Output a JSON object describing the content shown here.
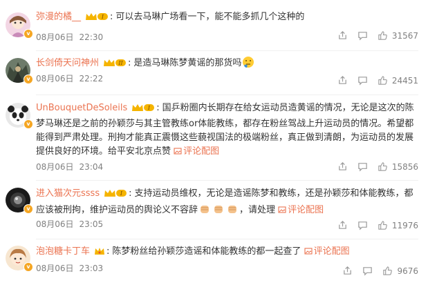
{
  "comments": [
    {
      "username": "弥漫的橘__",
      "level": "I",
      "content": "可以去马琳广场看一下，能不能多抓几个这种的",
      "date": "08月06日",
      "time": "22:30",
      "likes": "31567"
    },
    {
      "username": "长剑倚天问神州",
      "level": "II",
      "content": "是造马琳陈梦黄谣的那货吗",
      "date": "08月06日",
      "time": "22:22",
      "likes": "24451"
    },
    {
      "username": "UnBouquetDeSoleils",
      "level": "I",
      "content": "国乒粉圈内长期存在给女运动员造黄谣的情况，无论是这次的陈梦马琳还是之前的孙颖莎与其主管教练or体能教练，都存在粉丝驾战上升运动员的情况。希望都能得到严肃处理。刑拘才能真正震慑这些藐视国法的极端粉丝，真正做到清朗，为运动员的发展提供良好的环境。给平安北京点赞",
      "link": "评论配图",
      "date": "08月06日",
      "time": "23:04",
      "likes": "15856"
    },
    {
      "username": "进入猫次元ssss",
      "level": "I",
      "content": "支持运动员维权，无论是造谣陈梦和教练，还是孙颖莎和体能教练，都应该被刑拘，维护运动员的舆论义不容辞",
      "content_tail": "，请处理",
      "link": "评论配图",
      "date": "08月06日",
      "time": "23:05",
      "likes": "11976"
    },
    {
      "username": "泡泡糖卡丁车",
      "level": "",
      "content": "陈梦粉丝给孙颖莎造谣和体能教练的都一起查了",
      "link": "评论配图",
      "date": "08月06日",
      "time": "23:03",
      "likes": "9676"
    }
  ],
  "colors": {
    "username": "#eb7350",
    "meta": "#808080",
    "badge": "#f5a623"
  }
}
